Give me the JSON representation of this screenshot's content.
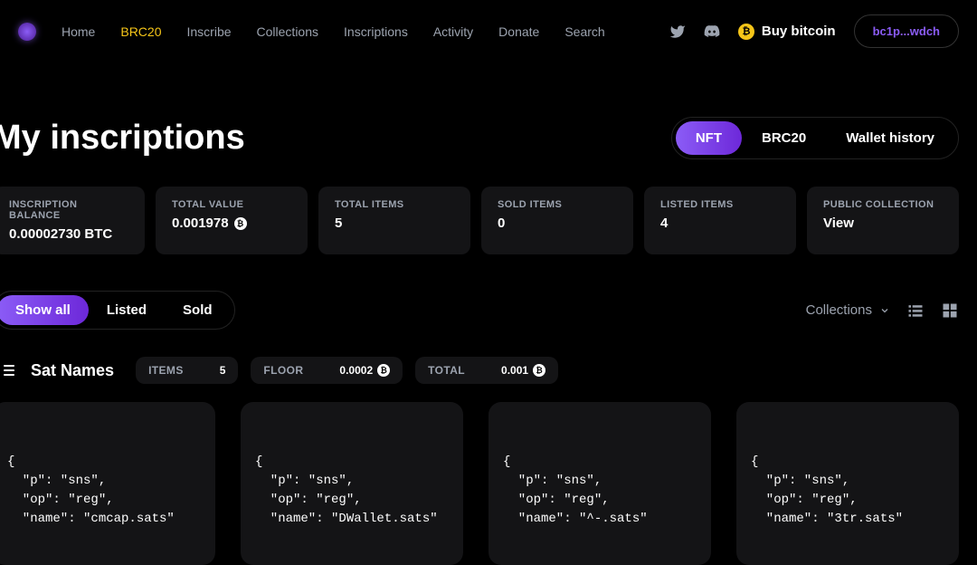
{
  "nav": {
    "home": "Home",
    "brc20": "BRC20",
    "inscribe": "Inscribe",
    "collections": "Collections",
    "inscriptions": "Inscriptions",
    "activity": "Activity",
    "donate": "Donate",
    "search": "Search"
  },
  "header": {
    "buy_bitcoin": "Buy bitcoin",
    "wallet_address": "bc1p...wdch"
  },
  "page_title": "My inscriptions",
  "view_tabs": {
    "nft": "NFT",
    "brc20": "BRC20",
    "wallet_history": "Wallet history"
  },
  "stats": [
    {
      "label": "INSCRIPTION BALANCE",
      "value": "0.00002730 BTC",
      "btc_icon": false
    },
    {
      "label": "TOTAL VALUE",
      "value": "0.001978",
      "btc_icon": true
    },
    {
      "label": "TOTAL ITEMS",
      "value": "5",
      "btc_icon": false
    },
    {
      "label": "SOLD ITEMS",
      "value": "0",
      "btc_icon": false
    },
    {
      "label": "LISTED ITEMS",
      "value": "4",
      "btc_icon": false
    },
    {
      "label": "PUBLIC COLLECTION",
      "value": "View",
      "btc_icon": false
    }
  ],
  "filter_tabs": {
    "show_all": "Show all",
    "listed": "Listed",
    "sold": "Sold"
  },
  "sort": {
    "label": "Collections"
  },
  "collection": {
    "name": "Sat Names",
    "items_label": "ITEMS",
    "items_value": "5",
    "floor_label": "FLOOR",
    "floor_value": "0.0002",
    "total_label": "TOTAL",
    "total_value": "0.001"
  },
  "cards": [
    "{\n  \"p\": \"sns\",\n  \"op\": \"reg\",\n  \"name\": \"cmcap.sats\"",
    "{\n  \"p\": \"sns\",\n  \"op\": \"reg\",\n  \"name\": \"DWallet.sats\"",
    "{\n  \"p\": \"sns\",\n  \"op\": \"reg\",\n  \"name\": \"^-.sats\"",
    "{\n  \"p\": \"sns\",\n  \"op\": \"reg\",\n  \"name\": \"3tr.sats\""
  ]
}
